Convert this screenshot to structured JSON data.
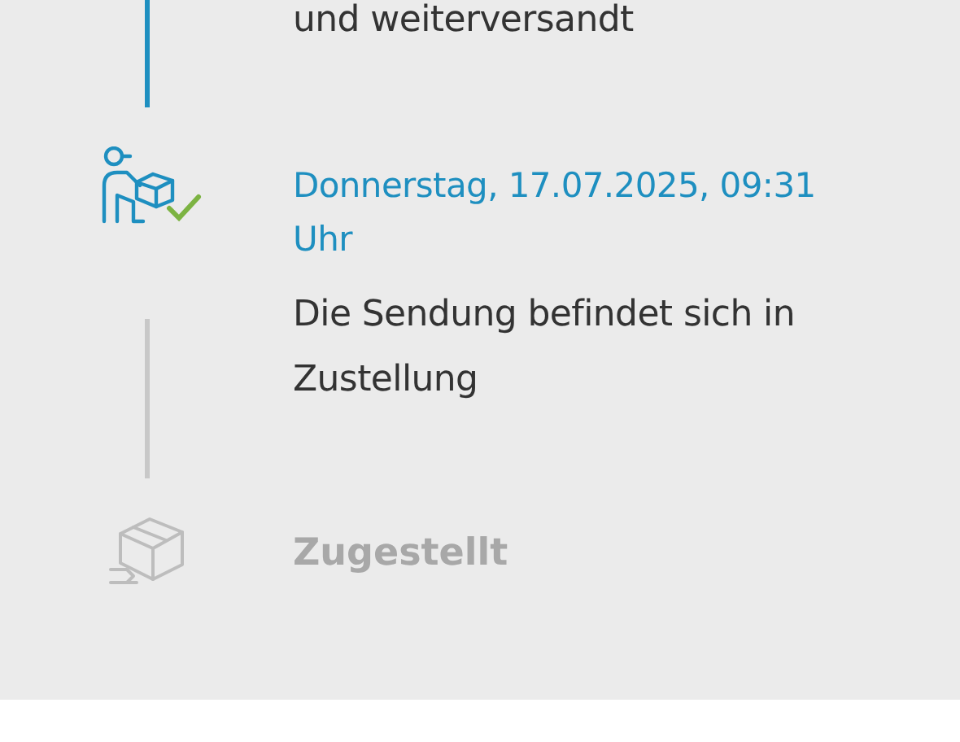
{
  "events": [
    {
      "kind": "done",
      "description": "und weiterversandt"
    },
    {
      "kind": "current",
      "date": "Donnerstag, 17.07.2025, 09:31 Uhr",
      "description": "Die Sendung befindet sich in Zustellung"
    },
    {
      "kind": "pending",
      "title": "Zugestellt"
    }
  ]
}
